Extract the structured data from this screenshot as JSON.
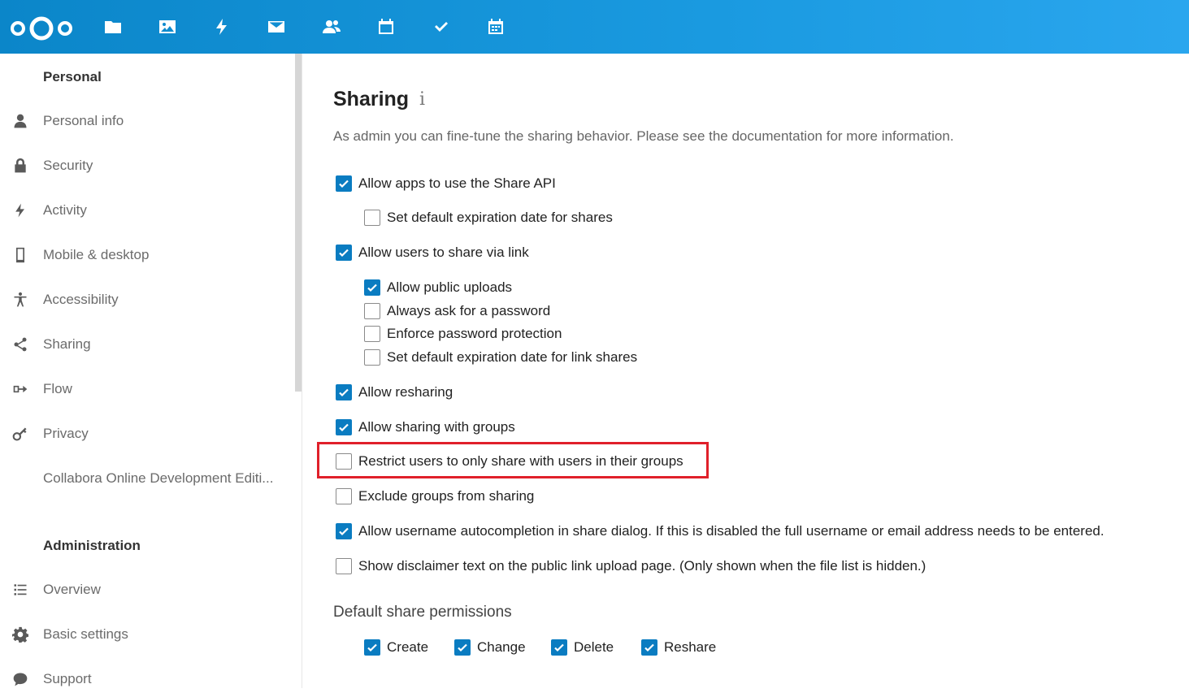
{
  "header": {
    "apps": [
      {
        "name": "files-icon"
      },
      {
        "name": "photos-icon"
      },
      {
        "name": "activity-icon"
      },
      {
        "name": "mail-icon"
      },
      {
        "name": "contacts-icon"
      },
      {
        "name": "calendar-icon"
      },
      {
        "name": "tasks-icon"
      },
      {
        "name": "deck-icon"
      }
    ],
    "accent": "#1a9ae0"
  },
  "sidebar": {
    "personal_title": "Personal",
    "personal_items": [
      {
        "label": "Personal info",
        "icon": "user-icon"
      },
      {
        "label": "Security",
        "icon": "lock-icon"
      },
      {
        "label": "Activity",
        "icon": "activity-icon"
      },
      {
        "label": "Mobile & desktop",
        "icon": "phone-icon"
      },
      {
        "label": "Accessibility",
        "icon": "accessibility-icon"
      },
      {
        "label": "Sharing",
        "icon": "share-icon"
      },
      {
        "label": "Flow",
        "icon": "flow-icon"
      },
      {
        "label": "Privacy",
        "icon": "key-icon"
      },
      {
        "label": "Collabora Online Development Editi...",
        "icon": ""
      }
    ],
    "admin_title": "Administration",
    "admin_items": [
      {
        "label": "Overview",
        "icon": "list-icon"
      },
      {
        "label": "Basic settings",
        "icon": "gear-icon"
      },
      {
        "label": "Support",
        "icon": "chat-icon"
      }
    ]
  },
  "main": {
    "title": "Sharing",
    "info_glyph": "i",
    "description": "As admin you can fine-tune the sharing behavior. Please see the documentation for more information.",
    "options": [
      {
        "label": "Allow apps to use the Share API",
        "checked": true
      },
      {
        "label": "Set default expiration date for shares",
        "checked": false
      },
      {
        "label": "Allow users to share via link",
        "checked": true
      },
      {
        "label": "Allow public uploads",
        "checked": true
      },
      {
        "label": "Always ask for a password",
        "checked": false
      },
      {
        "label": "Enforce password protection",
        "checked": false
      },
      {
        "label": "Set default expiration date for link shares",
        "checked": false
      },
      {
        "label": "Allow resharing",
        "checked": true
      },
      {
        "label": "Allow sharing with groups",
        "checked": true
      },
      {
        "label": "Restrict users to only share with users in their groups",
        "checked": false
      },
      {
        "label": "Exclude groups from sharing",
        "checked": false
      },
      {
        "label": "Allow username autocompletion in share dialog. If this is disabled the full username or email address needs to be entered.",
        "checked": true
      },
      {
        "label": "Show disclaimer text on the public link upload page. (Only shown when the file list is hidden.)",
        "checked": false
      }
    ],
    "permissions_title": "Default share permissions",
    "permissions": [
      {
        "label": "Create",
        "checked": true
      },
      {
        "label": "Change",
        "checked": true
      },
      {
        "label": "Delete",
        "checked": true
      },
      {
        "label": "Reshare",
        "checked": true
      }
    ],
    "highlight_color": "#e0202a"
  }
}
